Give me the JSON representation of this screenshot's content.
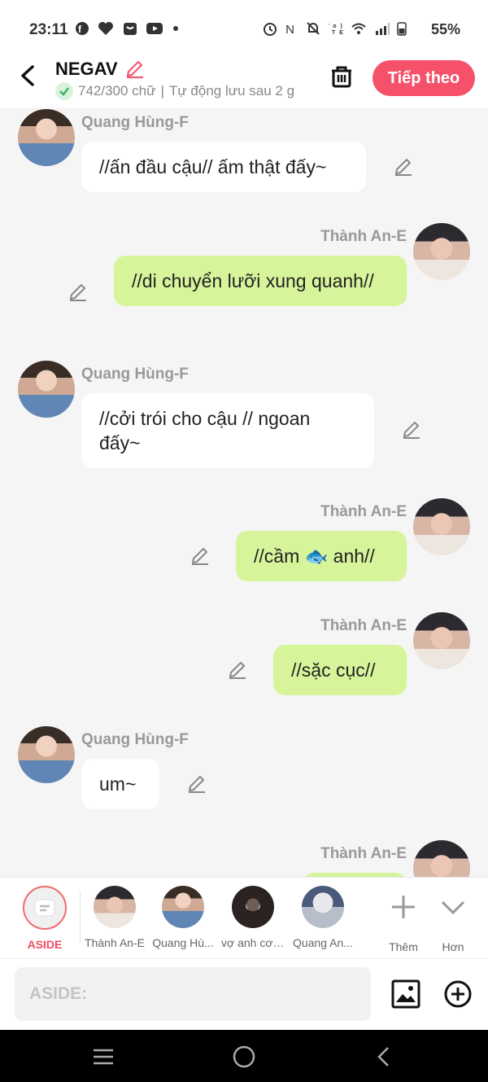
{
  "status_bar": {
    "time": "23:11",
    "battery": "55%"
  },
  "header": {
    "title": "NEGAV",
    "word_count": "742/300 chữ",
    "separator": "|",
    "autosave": "Tự động lưu sau 2 g",
    "next_label": "Tiếp theo"
  },
  "messages": [
    {
      "side": "left",
      "name": "Quang Hùng-F",
      "text": "//ấn đầu cậu// ấm thật đấy~"
    },
    {
      "side": "right",
      "name": "Thành An-E",
      "text": "//di chuyển lưỡi xung quanh//"
    },
    {
      "side": "left",
      "name": "Quang Hùng-F",
      "text": "//cởi trói cho cậu // ngoan đấy~"
    },
    {
      "side": "right",
      "name": "Thành An-E",
      "text": "//cầm 🐟 anh//"
    },
    {
      "side": "right",
      "name": "Thành An-E",
      "text": "//sặc cục//"
    },
    {
      "side": "left",
      "name": "Quang Hùng-F",
      "text": "um~"
    },
    {
      "side": "right",
      "name": "Thành An-E",
      "text": ""
    }
  ],
  "characters": [
    {
      "label": "ASIDE"
    },
    {
      "label": "Thành An-E"
    },
    {
      "label": "Quang Hù..."
    },
    {
      "label": "vợ anh cơ ..."
    },
    {
      "label": "Quang An..."
    },
    {
      "label": "Thêm"
    },
    {
      "label": "Hơn"
    }
  ],
  "input": {
    "placeholder": "ASIDE:"
  },
  "colors": {
    "accent": "#f5516b",
    "bubble_right": "#d6f59b",
    "bubble_left": "#ffffff"
  }
}
